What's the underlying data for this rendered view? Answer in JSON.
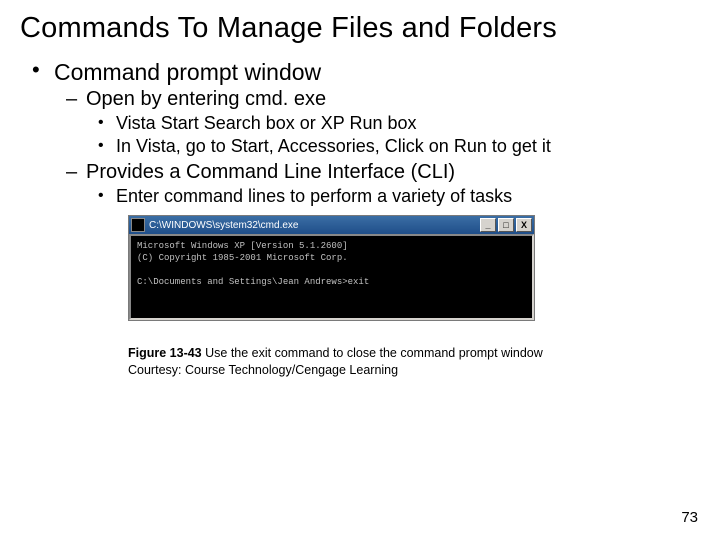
{
  "title": "Commands To Manage Files and Folders",
  "bullets": {
    "l1": "Command prompt window",
    "l2a": "Open by entering cmd. exe",
    "l3a": "Vista Start Search box or XP Run box",
    "l3b": "In Vista, go to Start, Accessories, Click on Run to get it",
    "l2b": "Provides a Command Line Interface (CLI)",
    "l3c": "Enter command lines to perform a variety of tasks"
  },
  "cmd": {
    "title": "C:\\WINDOWS\\system32\\cmd.exe",
    "min": "_",
    "max": "□",
    "close": "X",
    "line1": "Microsoft Windows XP [Version 5.1.2600]",
    "line2": "(C) Copyright 1985-2001 Microsoft Corp.",
    "blank": "",
    "line3": "C:\\Documents and Settings\\Jean Andrews>exit"
  },
  "caption": {
    "label": "Figure 13-43",
    "text": " Use the exit command to close the command prompt window",
    "courtesy": "Courtesy: Course Technology/Cengage Learning"
  },
  "page": "73"
}
